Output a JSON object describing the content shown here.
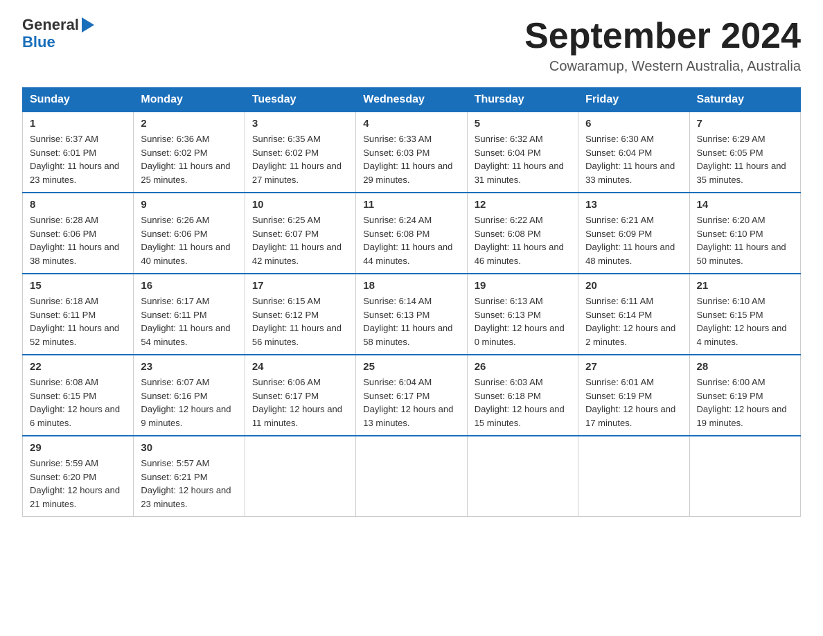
{
  "logo": {
    "part1": "General",
    "part2": "Blue"
  },
  "title": {
    "month": "September 2024",
    "location": "Cowaramup, Western Australia, Australia"
  },
  "weekdays": [
    "Sunday",
    "Monday",
    "Tuesday",
    "Wednesday",
    "Thursday",
    "Friday",
    "Saturday"
  ],
  "weeks": [
    [
      {
        "day": "1",
        "sunrise": "6:37 AM",
        "sunset": "6:01 PM",
        "daylight": "11 hours and 23 minutes."
      },
      {
        "day": "2",
        "sunrise": "6:36 AM",
        "sunset": "6:02 PM",
        "daylight": "11 hours and 25 minutes."
      },
      {
        "day": "3",
        "sunrise": "6:35 AM",
        "sunset": "6:02 PM",
        "daylight": "11 hours and 27 minutes."
      },
      {
        "day": "4",
        "sunrise": "6:33 AM",
        "sunset": "6:03 PM",
        "daylight": "11 hours and 29 minutes."
      },
      {
        "day": "5",
        "sunrise": "6:32 AM",
        "sunset": "6:04 PM",
        "daylight": "11 hours and 31 minutes."
      },
      {
        "day": "6",
        "sunrise": "6:30 AM",
        "sunset": "6:04 PM",
        "daylight": "11 hours and 33 minutes."
      },
      {
        "day": "7",
        "sunrise": "6:29 AM",
        "sunset": "6:05 PM",
        "daylight": "11 hours and 35 minutes."
      }
    ],
    [
      {
        "day": "8",
        "sunrise": "6:28 AM",
        "sunset": "6:06 PM",
        "daylight": "11 hours and 38 minutes."
      },
      {
        "day": "9",
        "sunrise": "6:26 AM",
        "sunset": "6:06 PM",
        "daylight": "11 hours and 40 minutes."
      },
      {
        "day": "10",
        "sunrise": "6:25 AM",
        "sunset": "6:07 PM",
        "daylight": "11 hours and 42 minutes."
      },
      {
        "day": "11",
        "sunrise": "6:24 AM",
        "sunset": "6:08 PM",
        "daylight": "11 hours and 44 minutes."
      },
      {
        "day": "12",
        "sunrise": "6:22 AM",
        "sunset": "6:08 PM",
        "daylight": "11 hours and 46 minutes."
      },
      {
        "day": "13",
        "sunrise": "6:21 AM",
        "sunset": "6:09 PM",
        "daylight": "11 hours and 48 minutes."
      },
      {
        "day": "14",
        "sunrise": "6:20 AM",
        "sunset": "6:10 PM",
        "daylight": "11 hours and 50 minutes."
      }
    ],
    [
      {
        "day": "15",
        "sunrise": "6:18 AM",
        "sunset": "6:11 PM",
        "daylight": "11 hours and 52 minutes."
      },
      {
        "day": "16",
        "sunrise": "6:17 AM",
        "sunset": "6:11 PM",
        "daylight": "11 hours and 54 minutes."
      },
      {
        "day": "17",
        "sunrise": "6:15 AM",
        "sunset": "6:12 PM",
        "daylight": "11 hours and 56 minutes."
      },
      {
        "day": "18",
        "sunrise": "6:14 AM",
        "sunset": "6:13 PM",
        "daylight": "11 hours and 58 minutes."
      },
      {
        "day": "19",
        "sunrise": "6:13 AM",
        "sunset": "6:13 PM",
        "daylight": "12 hours and 0 minutes."
      },
      {
        "day": "20",
        "sunrise": "6:11 AM",
        "sunset": "6:14 PM",
        "daylight": "12 hours and 2 minutes."
      },
      {
        "day": "21",
        "sunrise": "6:10 AM",
        "sunset": "6:15 PM",
        "daylight": "12 hours and 4 minutes."
      }
    ],
    [
      {
        "day": "22",
        "sunrise": "6:08 AM",
        "sunset": "6:15 PM",
        "daylight": "12 hours and 6 minutes."
      },
      {
        "day": "23",
        "sunrise": "6:07 AM",
        "sunset": "6:16 PM",
        "daylight": "12 hours and 9 minutes."
      },
      {
        "day": "24",
        "sunrise": "6:06 AM",
        "sunset": "6:17 PM",
        "daylight": "12 hours and 11 minutes."
      },
      {
        "day": "25",
        "sunrise": "6:04 AM",
        "sunset": "6:17 PM",
        "daylight": "12 hours and 13 minutes."
      },
      {
        "day": "26",
        "sunrise": "6:03 AM",
        "sunset": "6:18 PM",
        "daylight": "12 hours and 15 minutes."
      },
      {
        "day": "27",
        "sunrise": "6:01 AM",
        "sunset": "6:19 PM",
        "daylight": "12 hours and 17 minutes."
      },
      {
        "day": "28",
        "sunrise": "6:00 AM",
        "sunset": "6:19 PM",
        "daylight": "12 hours and 19 minutes."
      }
    ],
    [
      {
        "day": "29",
        "sunrise": "5:59 AM",
        "sunset": "6:20 PM",
        "daylight": "12 hours and 21 minutes."
      },
      {
        "day": "30",
        "sunrise": "5:57 AM",
        "sunset": "6:21 PM",
        "daylight": "12 hours and 23 minutes."
      },
      null,
      null,
      null,
      null,
      null
    ]
  ]
}
